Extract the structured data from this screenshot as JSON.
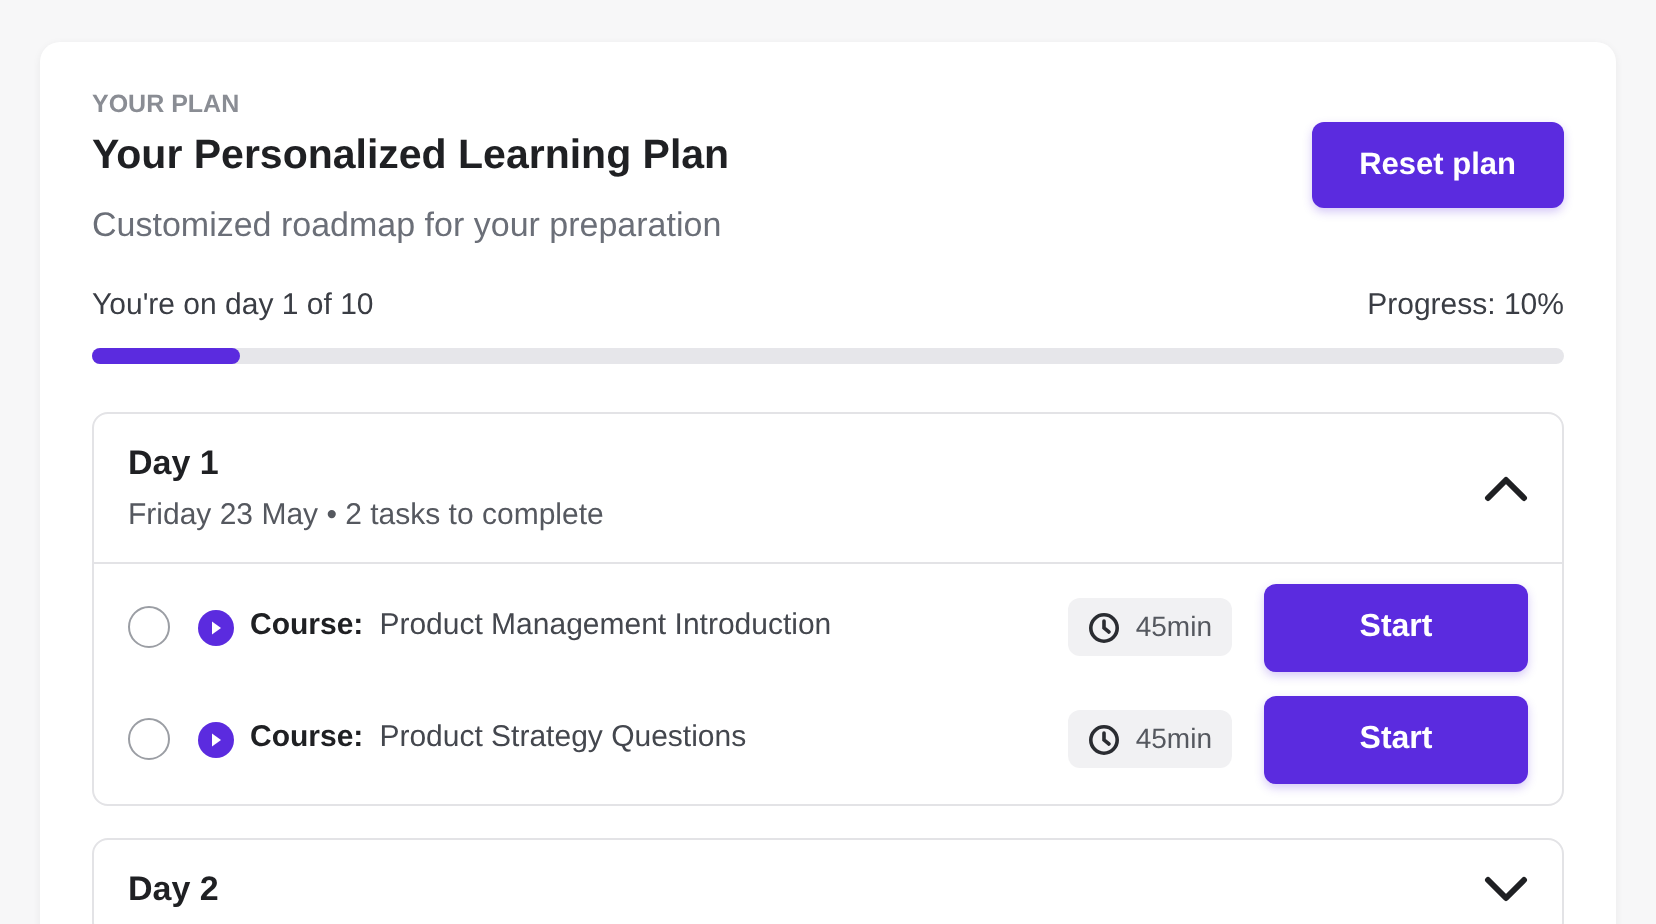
{
  "plan": {
    "eyebrow": "YOUR PLAN",
    "title": "Your Personalized Learning Plan",
    "subtitle": "Customized roadmap for your preparation",
    "reset_button": "Reset plan",
    "day_status": "You're on day 1 of 10",
    "progress_label": "Progress: 10%",
    "level": 0.1
  },
  "days": [
    {
      "title": "Day 1",
      "subtitle": "Friday 23 May • 2 tasks to complete",
      "expanded": true,
      "tasks": [
        {
          "checked": false,
          "type_label": "Course:",
          "name": "Product Management Introduction",
          "duration": "45min",
          "button": "Start"
        },
        {
          "checked": false,
          "type_label": "Course:",
          "name": "Product Strategy Questions",
          "duration": "45min",
          "button": "Start"
        }
      ]
    },
    {
      "title": "Day 2",
      "expanded": false
    }
  ]
}
